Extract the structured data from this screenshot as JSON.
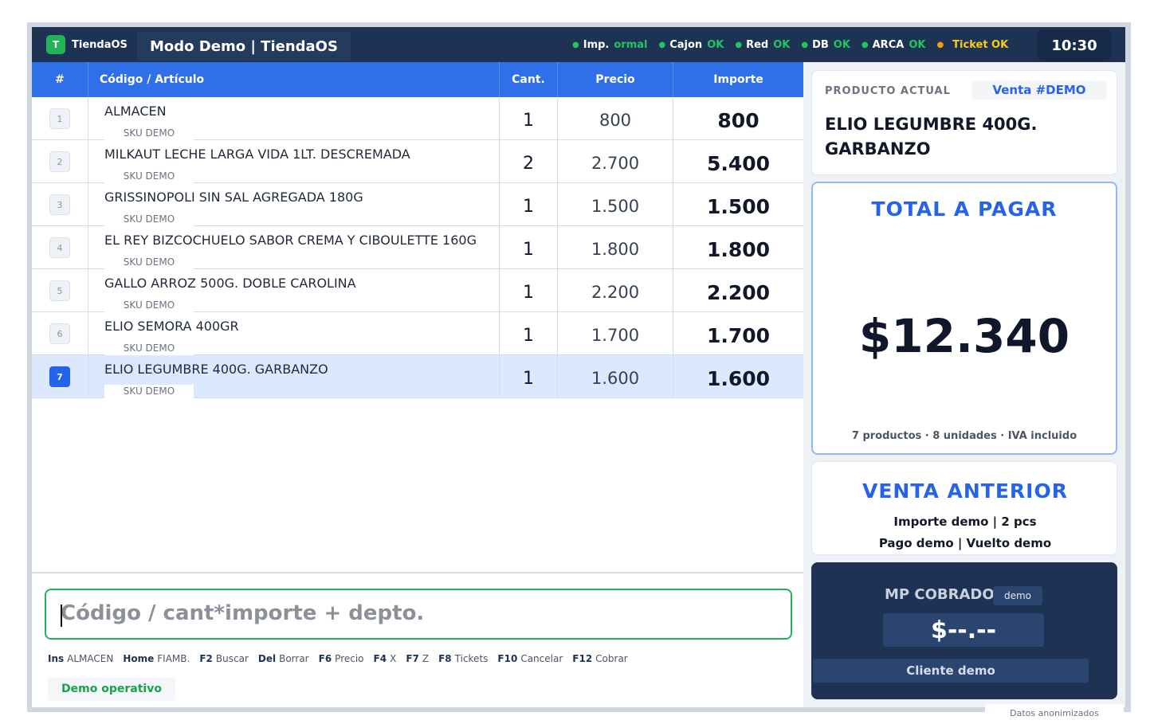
{
  "brand": {
    "logo_letter": "T",
    "name": "TiendaOS"
  },
  "header": {
    "mode_title": "Modo Demo  |  TiendaOS",
    "clock": "10:30"
  },
  "status": [
    {
      "label": "Imp.",
      "value": "ormal",
      "tone": "ok"
    },
    {
      "label": "Cajon",
      "value": "OK",
      "tone": "ok"
    },
    {
      "label": "Red",
      "value": "OK",
      "tone": "ok"
    },
    {
      "label": "DB",
      "value": "OK",
      "tone": "ok"
    },
    {
      "label": "ARCA",
      "value": "OK",
      "tone": "ok"
    },
    {
      "label": "",
      "value": "Ticket OK",
      "tone": "warn"
    }
  ],
  "table": {
    "headers": {
      "num": "#",
      "articulo": "Código / Artículo",
      "cant": "Cant.",
      "precio": "Precio",
      "importe": "Importe"
    },
    "rows": [
      {
        "n": "1",
        "name": "ALMACEN",
        "sku": "SKU DEMO",
        "cant": "1",
        "precio": "800",
        "importe": "800",
        "selected": false
      },
      {
        "n": "2",
        "name": "MILKAUT LECHE LARGA VIDA 1LT. DESCREMADA",
        "sku": "SKU DEMO",
        "cant": "2",
        "precio": "2.700",
        "importe": "5.400",
        "selected": false
      },
      {
        "n": "3",
        "name": "GRISSINOPOLI SIN SAL AGREGADA 180G",
        "sku": "SKU DEMO",
        "cant": "1",
        "precio": "1.500",
        "importe": "1.500",
        "selected": false
      },
      {
        "n": "4",
        "name": "EL REY BIZCOCHUELO SABOR CREMA Y CIBOULETTE 160G",
        "sku": "SKU DEMO",
        "cant": "1",
        "precio": "1.800",
        "importe": "1.800",
        "selected": false
      },
      {
        "n": "5",
        "name": "GALLO ARROZ 500G. DOBLE CAROLINA",
        "sku": "SKU DEMO",
        "cant": "1",
        "precio": "2.200",
        "importe": "2.200",
        "selected": false
      },
      {
        "n": "6",
        "name": "ELIO SEMORA 400GR",
        "sku": "SKU DEMO",
        "cant": "1",
        "precio": "1.700",
        "importe": "1.700",
        "selected": false
      },
      {
        "n": "7",
        "name": "ELIO LEGUMBRE 400G. GARBANZO",
        "sku": "SKU DEMO",
        "cant": "1",
        "precio": "1.600",
        "importe": "1.600",
        "selected": true
      }
    ]
  },
  "input": {
    "placeholder": "Código / cant*importe + depto."
  },
  "shortcuts": [
    {
      "key": "Ins",
      "label": "ALMACEN"
    },
    {
      "key": "Home",
      "label": "FIAMB."
    },
    {
      "key": "F2",
      "label": "Buscar"
    },
    {
      "key": "Del",
      "label": "Borrar"
    },
    {
      "key": "F6",
      "label": "Precio"
    },
    {
      "key": "F4",
      "label": "X"
    },
    {
      "key": "F7",
      "label": "Z"
    },
    {
      "key": "F8",
      "label": "Tickets"
    },
    {
      "key": "F10",
      "label": "Cancelar"
    },
    {
      "key": "F12",
      "label": "Cobrar"
    }
  ],
  "demo_status": "Demo operativo",
  "producto_actual": {
    "label": "PRODUCTO ACTUAL",
    "venta": "Venta #DEMO",
    "name": "ELIO LEGUMBRE 400G. GARBANZO"
  },
  "total": {
    "title": "TOTAL A PAGAR",
    "amount": "$12.340",
    "meta": "7 productos  ·  8 unidades  ·  IVA incluido"
  },
  "venta_anterior": {
    "title": "VENTA ANTERIOR",
    "line1": "Importe demo  |  2 pcs",
    "line2": "Pago demo  |  Vuelto demo"
  },
  "mp": {
    "title": "MP COBRADO",
    "badge": "demo",
    "amount": "$--.--",
    "client": "Cliente demo"
  },
  "footer_note": "Datos anonimizados",
  "colors": {
    "accent": "#2563eb",
    "header_bg": "#1e3354",
    "ok": "#22c55e",
    "warn": "#facc15"
  }
}
